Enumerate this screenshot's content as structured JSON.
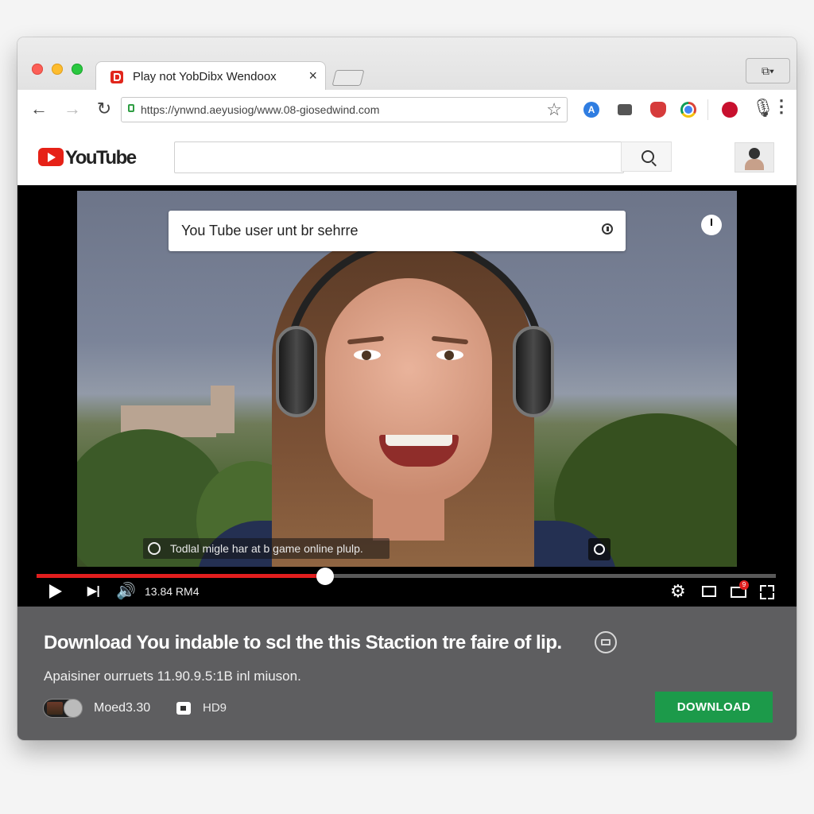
{
  "browser": {
    "tab": {
      "title": "Play not YobDibx  Wendoox",
      "close_glyph": "×",
      "favicon": "youtube-favicon"
    },
    "window_button_glyph": "⧉▾",
    "toolbar": {
      "back_glyph": "←",
      "forward_glyph": "→",
      "reload_glyph": "↻",
      "url": "https://ynwnd.aeyusiog/www.08-giosedwind.com",
      "bookmark_glyph": "☆",
      "extension_a_label": "A",
      "mic_glyph": "🎙",
      "menu_glyph": "⋮"
    }
  },
  "youtube": {
    "logo_text": "YouTube",
    "search": {
      "value": "",
      "placeholder": ""
    },
    "search_button_icon": "search-icon",
    "avatar": "user-avatar"
  },
  "player": {
    "overlay_search_text": "You Tube user unt br sehrre",
    "share_glyph": "➦",
    "caption_text": "Todlal migle har at b game online plulp.",
    "progress_fraction": 0.39,
    "next_glyph": "▶|",
    "volume_glyph": "🔊",
    "time_text": "13.84 RM4",
    "settings_glyph": "⚙",
    "notification_count": "9"
  },
  "info": {
    "title": "Download You indable to scl the this Staction tre faire of lip.",
    "subtitle": "Apaisiner ourruets 11.90.9.5:1B inl miuson.",
    "mode_text": "Moed3.30",
    "quality_text": "HD9",
    "download_label": "DOWNLOAD"
  },
  "colors": {
    "brand_red": "#e62117",
    "progress_red": "#e11e1e",
    "download_green": "#1c9a4a",
    "info_panel_bg": "#5e5e60"
  }
}
